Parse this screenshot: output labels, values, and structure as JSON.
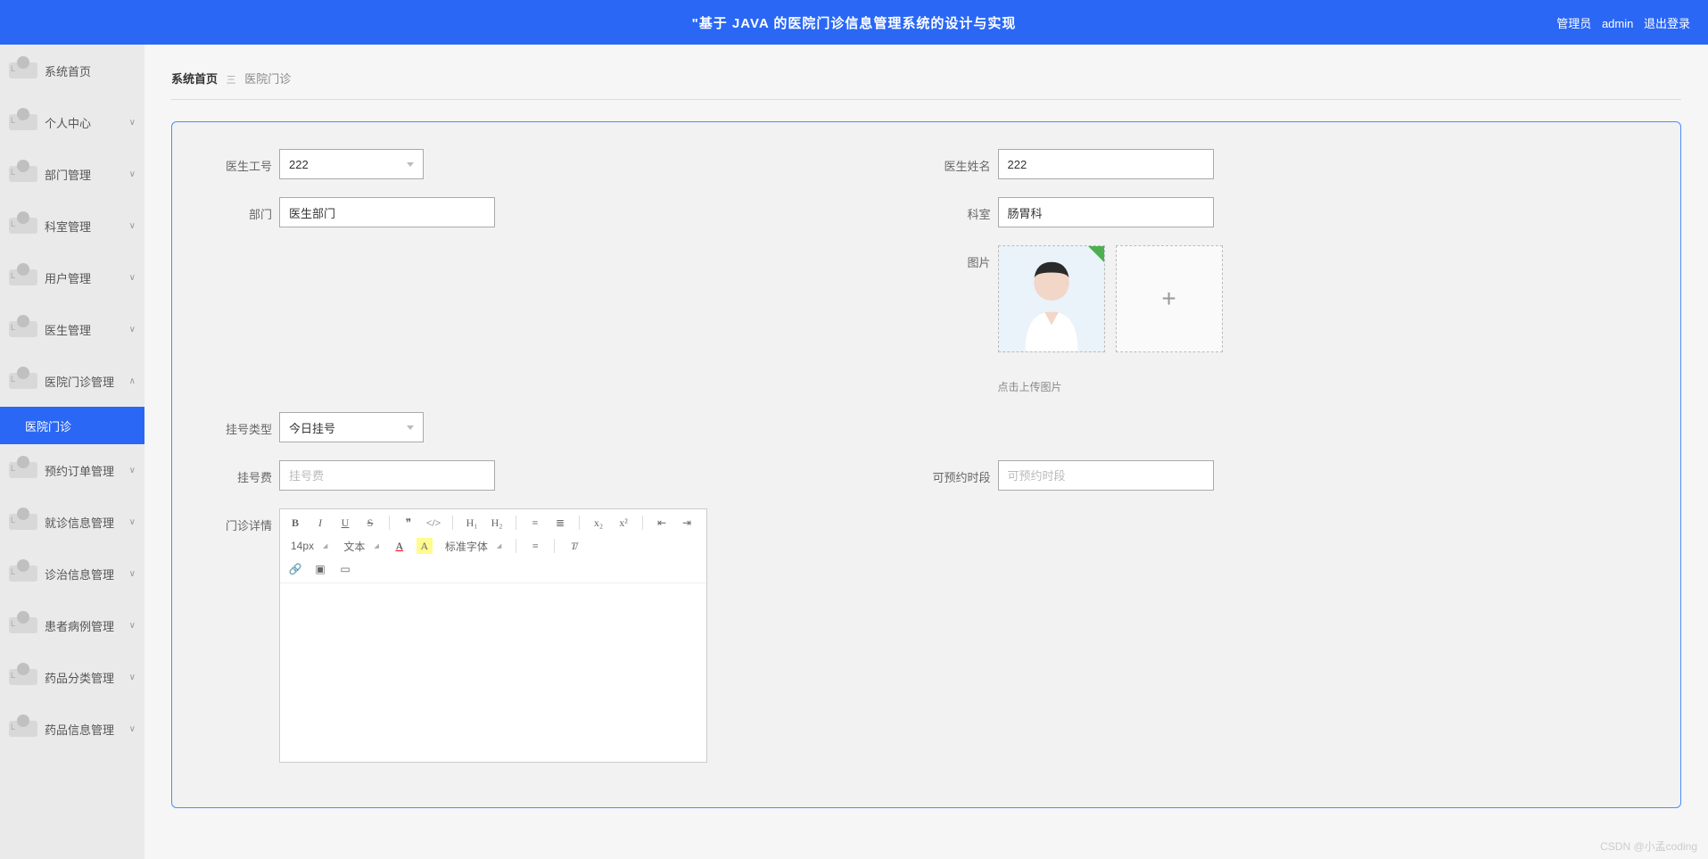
{
  "header": {
    "title": "\"基于 JAVA 的医院门诊信息管理系统的设计与实现",
    "role": "管理员",
    "user": "admin",
    "logout": "退出登录"
  },
  "sidebar": {
    "items": [
      {
        "label": "系统首页",
        "expandable": false
      },
      {
        "label": "个人中心",
        "expandable": true
      },
      {
        "label": "部门管理",
        "expandable": true
      },
      {
        "label": "科室管理",
        "expandable": true
      },
      {
        "label": "用户管理",
        "expandable": true
      },
      {
        "label": "医生管理",
        "expandable": true
      },
      {
        "label": "医院门诊管理",
        "expandable": true,
        "expanded": true
      },
      {
        "label": "医院门诊",
        "active": true,
        "sub": true
      },
      {
        "label": "预约订单管理",
        "expandable": true
      },
      {
        "label": "就诊信息管理",
        "expandable": true
      },
      {
        "label": "诊治信息管理",
        "expandable": true
      },
      {
        "label": "患者病例管理",
        "expandable": true
      },
      {
        "label": "药品分类管理",
        "expandable": true
      },
      {
        "label": "药品信息管理",
        "expandable": true
      }
    ]
  },
  "breadcrumb": {
    "home": "系统首页",
    "current": "医院门诊"
  },
  "form": {
    "doctor_id_label": "医生工号",
    "doctor_id_value": "222",
    "doctor_name_label": "医生姓名",
    "doctor_name_value": "222",
    "department_label": "部门",
    "department_value": "医生部门",
    "office_label": "科室",
    "office_value": "肠胃科",
    "image_label": "图片",
    "upload_hint": "点击上传图片",
    "reg_type_label": "挂号类型",
    "reg_type_value": "今日挂号",
    "reg_fee_label": "挂号费",
    "reg_fee_placeholder": "挂号费",
    "time_slot_label": "可预约时段",
    "time_slot_placeholder": "可预约时段",
    "detail_label": "门诊详情"
  },
  "editor": {
    "font_size": "14px",
    "text_type": "文本",
    "font_family": "标准字体"
  },
  "watermark": "CSDN @小孟coding"
}
